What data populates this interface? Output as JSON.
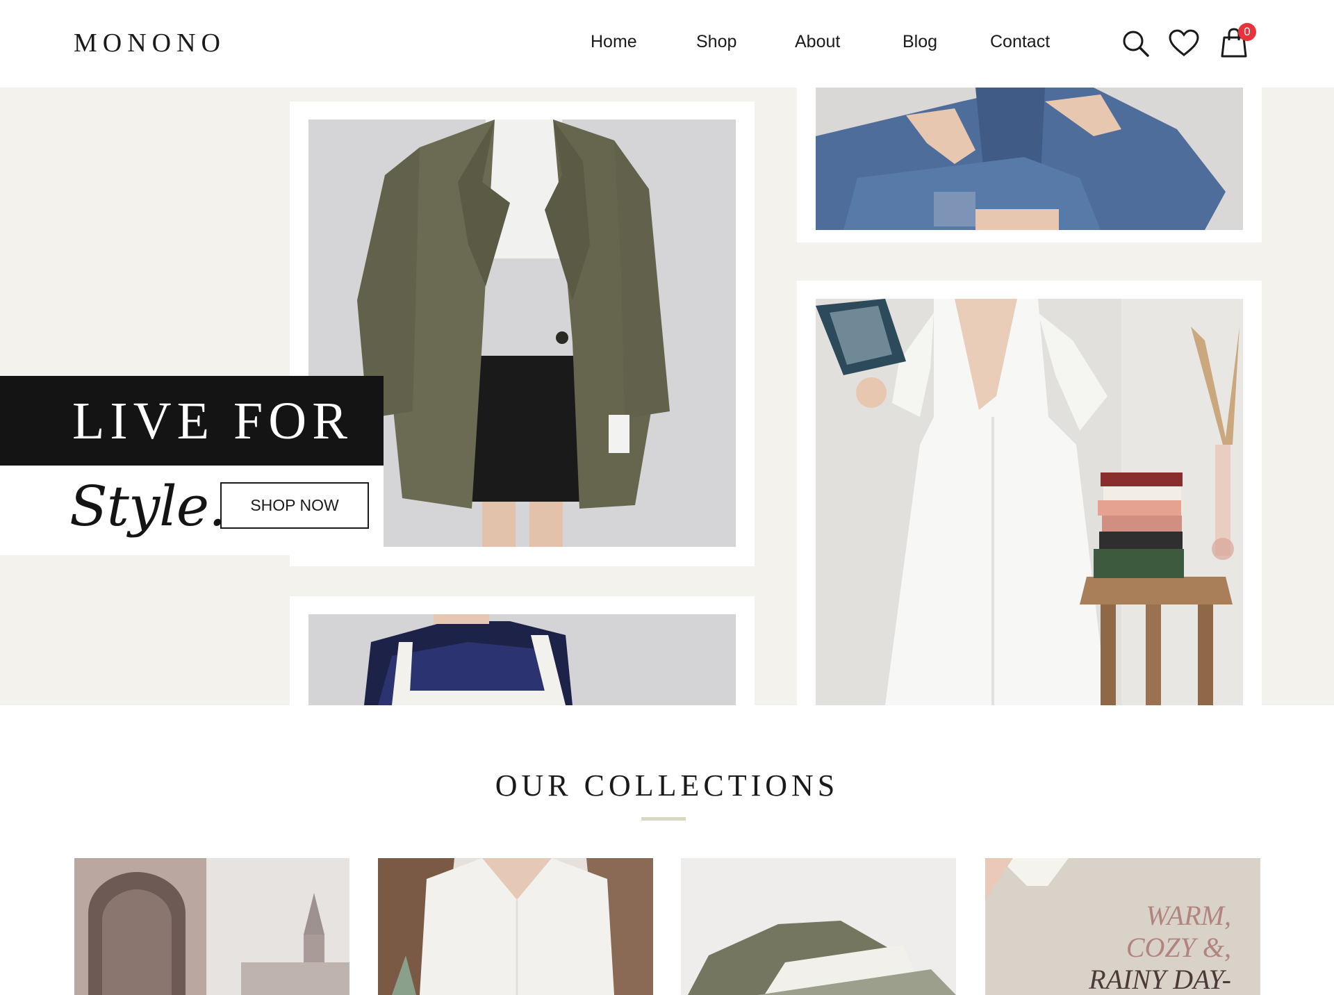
{
  "header": {
    "logo": "MONONO",
    "nav": [
      "Home",
      "Shop",
      "About",
      "Blog",
      "Contact"
    ],
    "cart_count": "0",
    "icons": [
      "search-icon",
      "heart-icon",
      "cart-icon"
    ]
  },
  "hero": {
    "title": "LIVE FOR",
    "script": "Style.",
    "button": "SHOP NOW"
  },
  "collections": {
    "title": "OUR COLLECTIONS",
    "card4_text": [
      "WARM,",
      "COZY &,",
      "RAINY DAY-"
    ]
  },
  "colors": {
    "hero_bg": "#f3f2ed",
    "banner_dark": "#141414",
    "accent_line": "#d8d8c2",
    "badge": "#e8333c",
    "card4_text": "#b2847f"
  }
}
